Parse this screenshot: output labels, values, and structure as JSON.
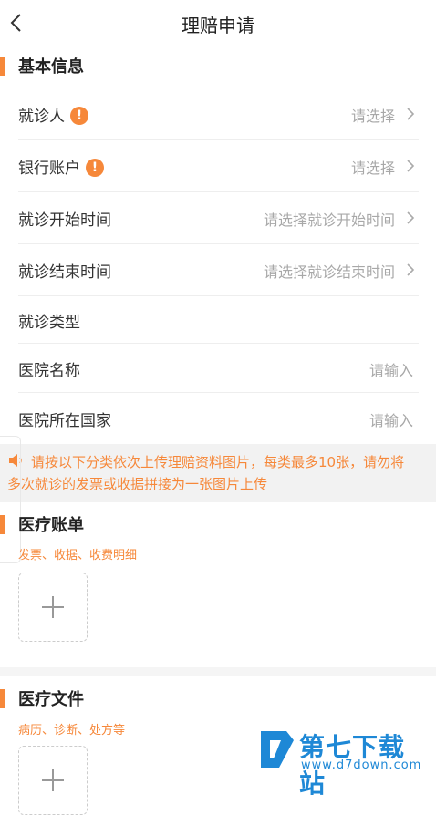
{
  "header": {
    "title": "理赔申请"
  },
  "basic_info": {
    "title": "基本信息",
    "rows": [
      {
        "label": "就诊人",
        "value": "请选择",
        "has_warning": true,
        "has_chevron": true
      },
      {
        "label": "银行账户",
        "value": "请选择",
        "has_warning": true,
        "has_chevron": true
      },
      {
        "label": "就诊开始时间",
        "value": "请选择就诊开始时间",
        "has_chevron": true
      },
      {
        "label": "就诊结束时间",
        "value": "请选择就诊结束时间",
        "has_chevron": true
      },
      {
        "label": "就诊类型",
        "value": ""
      },
      {
        "label": "医院名称",
        "value": "请输入"
      },
      {
        "label": "医院所在国家",
        "value": "请输入"
      }
    ]
  },
  "notice": {
    "text": "请按以下分类依次上传理赔资料图片，每类最多10张，请勿将多次就诊的发票或收据拼接为一张图片上传"
  },
  "medical_bill": {
    "title": "医疗账单",
    "subtitle": "发票、收据、收费明细"
  },
  "medical_docs": {
    "title": "医疗文件",
    "subtitle": "病历、诊断、处方等"
  },
  "watermark": {
    "name": "第七下载站",
    "url": "www.d7down.com"
  },
  "warning_glyph": "!",
  "colors": {
    "accent": "#f6883a",
    "placeholder": "#a8a8a8",
    "watermark": "#1e88d6"
  },
  "icons": {
    "back": "chevron-left-icon",
    "row": "chevron-right-icon",
    "notice": "speaker-icon",
    "upload": "plus-icon"
  }
}
